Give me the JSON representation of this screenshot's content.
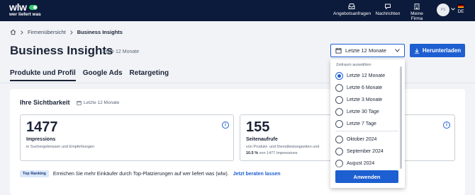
{
  "header": {
    "logo_text": "wlw",
    "logo_subtitle": "wer liefert was",
    "nav": [
      {
        "label": "Angebotsanfragen",
        "icon": "inbox-icon"
      },
      {
        "label": "Nachrichten",
        "icon": "chat-icon"
      },
      {
        "label": "Meine Firma",
        "icon": "building-icon"
      }
    ],
    "avatar_initials": "PS",
    "language": "DE"
  },
  "breadcrumb": {
    "items": [
      "Firmenübersicht",
      "Business Insights"
    ]
  },
  "page": {
    "title": "Business Insights",
    "subtitle": "Letzte 12 Monate"
  },
  "date_select": {
    "value": "Letzte 12 Monate"
  },
  "download_label": "Herunterladen",
  "tabs": [
    {
      "label": "Produkte und Profil",
      "active": true
    },
    {
      "label": "Google Ads",
      "active": false
    },
    {
      "label": "Retargeting",
      "active": false
    }
  ],
  "visibility": {
    "title": "Ihre Sichtbarkeit",
    "period": "Letzte 12 Monate",
    "cards": [
      {
        "value": "1477",
        "label": "Impressions",
        "description": "in Suchergebnissen und Empfehlungen"
      },
      {
        "value": "155",
        "label": "Seitenaufrufe",
        "description": "von Produkt- und Dienstleistungseiten und",
        "pct_value": "10.5 %",
        "pct_text": " von 1477 Impressions"
      }
    ]
  },
  "promo": {
    "badge": "Top Ranking",
    "text": "Erreichen Sie mehr Einkäufer durch Top-Platzierungen auf wer liefert was (wlw).",
    "link": "Jetzt beraten lassen"
  },
  "dropdown": {
    "heading": "Zeitraum auswählen",
    "options": [
      {
        "label": "Letzte 12 Monate",
        "selected": true
      },
      {
        "label": "Letzte 6 Monate",
        "selected": false
      },
      {
        "label": "Letzte 3 Monate",
        "selected": false
      },
      {
        "label": "Letzte 30 Tage",
        "selected": false
      },
      {
        "label": "Letzte 7 Tage",
        "selected": false
      },
      {
        "label": "Oktober 2024",
        "selected": false
      },
      {
        "label": "September 2024",
        "selected": false
      },
      {
        "label": "August 2024",
        "selected": false
      }
    ],
    "apply_label": "Anwenden"
  },
  "colors": {
    "navy": "#0c1a3b",
    "accent": "#1d5fd1"
  }
}
